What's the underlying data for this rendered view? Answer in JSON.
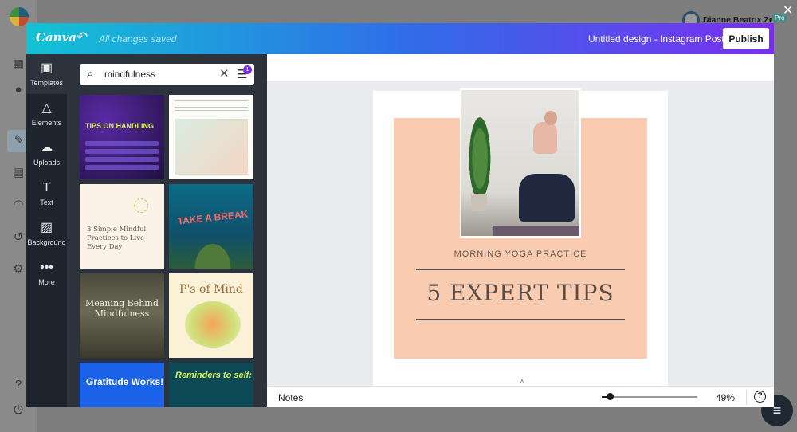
{
  "wp": {
    "user_name": "Dianne Beatrix Zee",
    "user_badge": "Pro",
    "close_glyph": "✕",
    "icons": [
      "dashboard-icon",
      "coin-icon",
      "posts-icon",
      "forms-icon",
      "rss-icon",
      "history-icon",
      "settings-icon",
      "help-icon",
      "power-icon"
    ]
  },
  "editor": {
    "brand": "Canva",
    "save_status": "All changes saved",
    "doc_title": "Untitled design - Instagram Post",
    "publish_label": "Publish"
  },
  "rail": {
    "items": [
      {
        "label": "Templates",
        "icon": "templates-icon"
      },
      {
        "label": "Elements",
        "icon": "elements-icon"
      },
      {
        "label": "Uploads",
        "icon": "uploads-icon"
      },
      {
        "label": "Text",
        "icon": "text-icon"
      },
      {
        "label": "Background",
        "icon": "background-icon"
      },
      {
        "label": "More",
        "icon": "more-icon"
      }
    ]
  },
  "panel": {
    "search_value": "mindfulness",
    "filter_count": "1",
    "templates": [
      {
        "text": "TIPS ON HANDLING"
      },
      {
        "text": ""
      },
      {
        "text": "3 Simple Mindful Practices to Live Every Day"
      },
      {
        "text": "TAKE A BREAK"
      },
      {
        "text": "Meaning Behind Mindfulness"
      },
      {
        "text": "P's of Mind"
      },
      {
        "text": "Gratitude Works!"
      },
      {
        "text": "Reminders to self:"
      }
    ]
  },
  "design": {
    "subtitle": "MORNING YOGA PRACTICE",
    "headline": "5 EXPERT TIPS",
    "colors": {
      "peach": "#f9cbb0",
      "text": "#5b4c45"
    }
  },
  "bottom": {
    "notes_label": "Notes",
    "zoom": "49%",
    "zoom_fraction": 0.1,
    "help_glyph": "?"
  }
}
